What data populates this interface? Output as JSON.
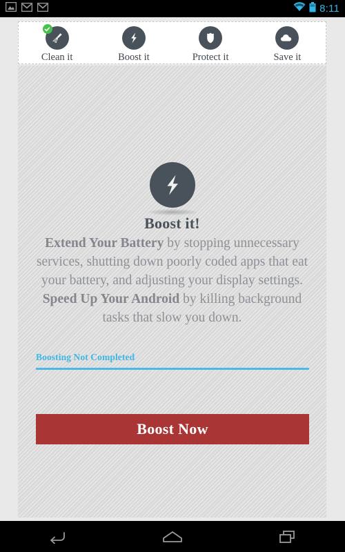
{
  "statusbar": {
    "notification_icons": [
      "image-icon",
      "email-icon",
      "email-icon"
    ],
    "wifi_icon": "wifi-icon",
    "battery_icon": "battery-icon",
    "clock": "8:11",
    "accent_color": "#33b5e5"
  },
  "tabs": [
    {
      "label": "Clean it",
      "icon": "broom-icon",
      "badge": "check-badge-icon",
      "selected": false
    },
    {
      "label": "Boost it",
      "icon": "lightning-bolt-icon",
      "badge": null,
      "selected": true
    },
    {
      "label": "Protect it",
      "icon": "shield-icon",
      "badge": null,
      "selected": false
    },
    {
      "label": "Save it",
      "icon": "cloud-icon",
      "badge": null,
      "selected": false
    }
  ],
  "main": {
    "hero_icon": "lightning-bolt-icon",
    "headline": "Boost it!",
    "body": {
      "lead_strong": "Extend Your Battery",
      "lead_rest": " by stopping unnecessary services, shutting down poorly coded apps that eat your battery, and adjusting your display settings. ",
      "second_strong": "Speed Up Your Android",
      "second_rest": " by killing background tasks that slow you down."
    },
    "status_text": "Boosting Not Completed",
    "status_color": "#3fb6e3",
    "cta_label": "Boost Now",
    "cta_color": "#a93535",
    "icon_color": "#49525a"
  },
  "navbar": {
    "back": "back-icon",
    "home": "home-icon",
    "recents": "recents-icon"
  }
}
